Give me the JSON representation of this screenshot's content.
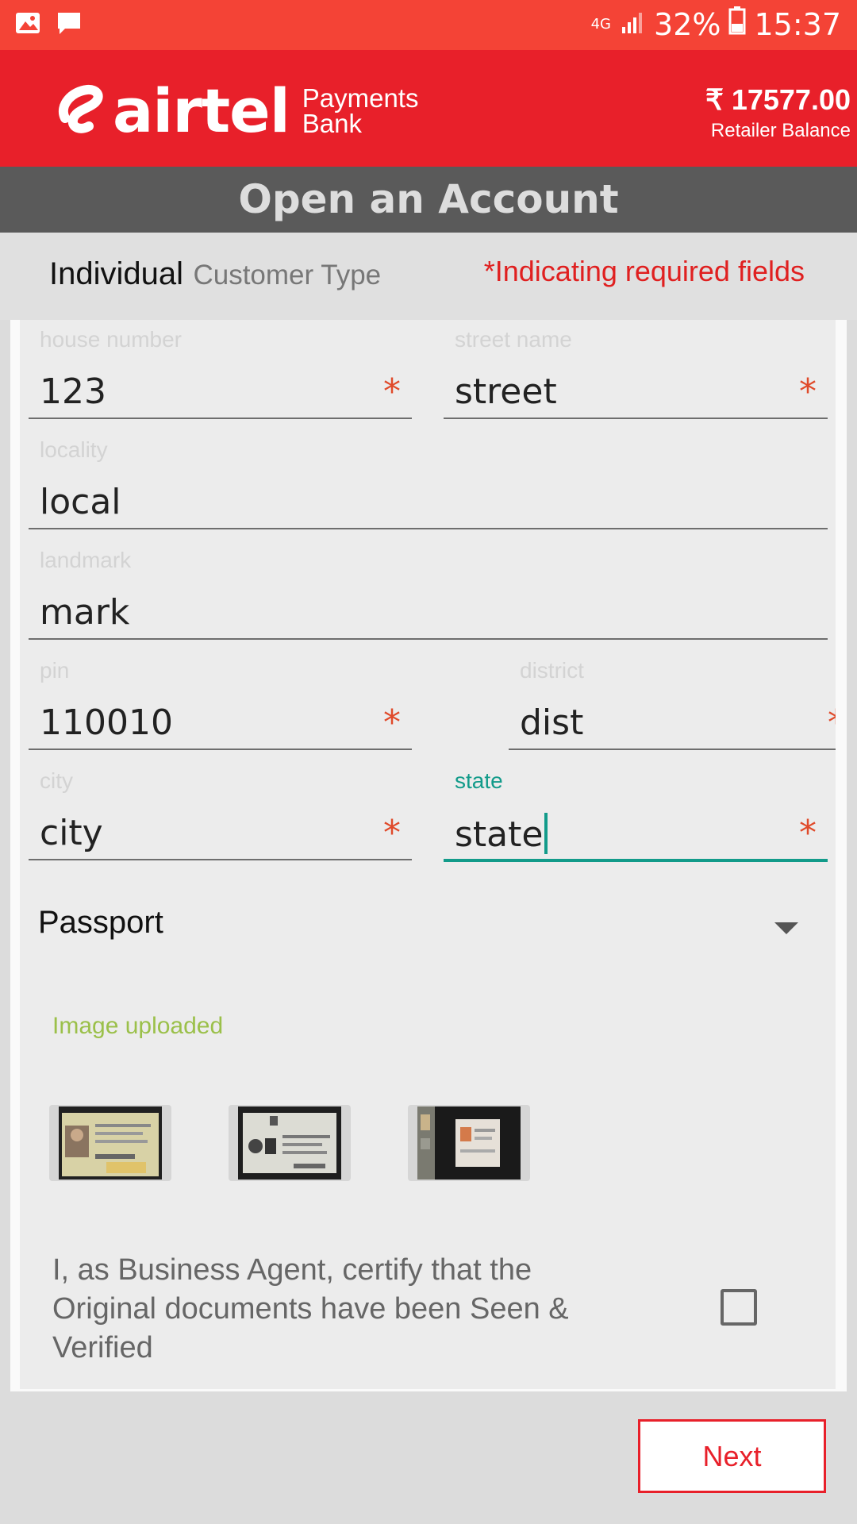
{
  "status_bar": {
    "left_icons": [
      "gallery-icon",
      "message-icon"
    ],
    "network": "4G",
    "battery": "32%",
    "time": "15:37"
  },
  "header": {
    "brand": "airtel",
    "brand_sub_1": "Payments",
    "brand_sub_2": "Bank",
    "balance": "₹ 17577.00",
    "balance_label": "Retailer Balance",
    "color": "#e8202a"
  },
  "title": "Open an Account",
  "customer_type": {
    "value": "Individual",
    "label": "Customer Type",
    "required_note": "*Indicating required fields"
  },
  "form": {
    "house_number": {
      "label": "house number",
      "value": "123",
      "required": "*"
    },
    "street_name": {
      "label": "street name",
      "value": "street",
      "required": "*"
    },
    "locality": {
      "label": "locality",
      "value": "local"
    },
    "landmark": {
      "label": "landmark",
      "value": "mark"
    },
    "pin": {
      "label": "pin",
      "value": "110010",
      "required": "*"
    },
    "district": {
      "label": "district",
      "value": "dist",
      "required": "*"
    },
    "city": {
      "label": "city",
      "value": "city",
      "required": "*"
    },
    "state": {
      "label": "state",
      "value": "state",
      "required": "*"
    },
    "document_type": "Passport",
    "upload_status": "Image uploaded",
    "certify_text": "I, as Business Agent, certify that the Original documents have been Seen & Verified",
    "certified": false
  },
  "next_label": "Next"
}
